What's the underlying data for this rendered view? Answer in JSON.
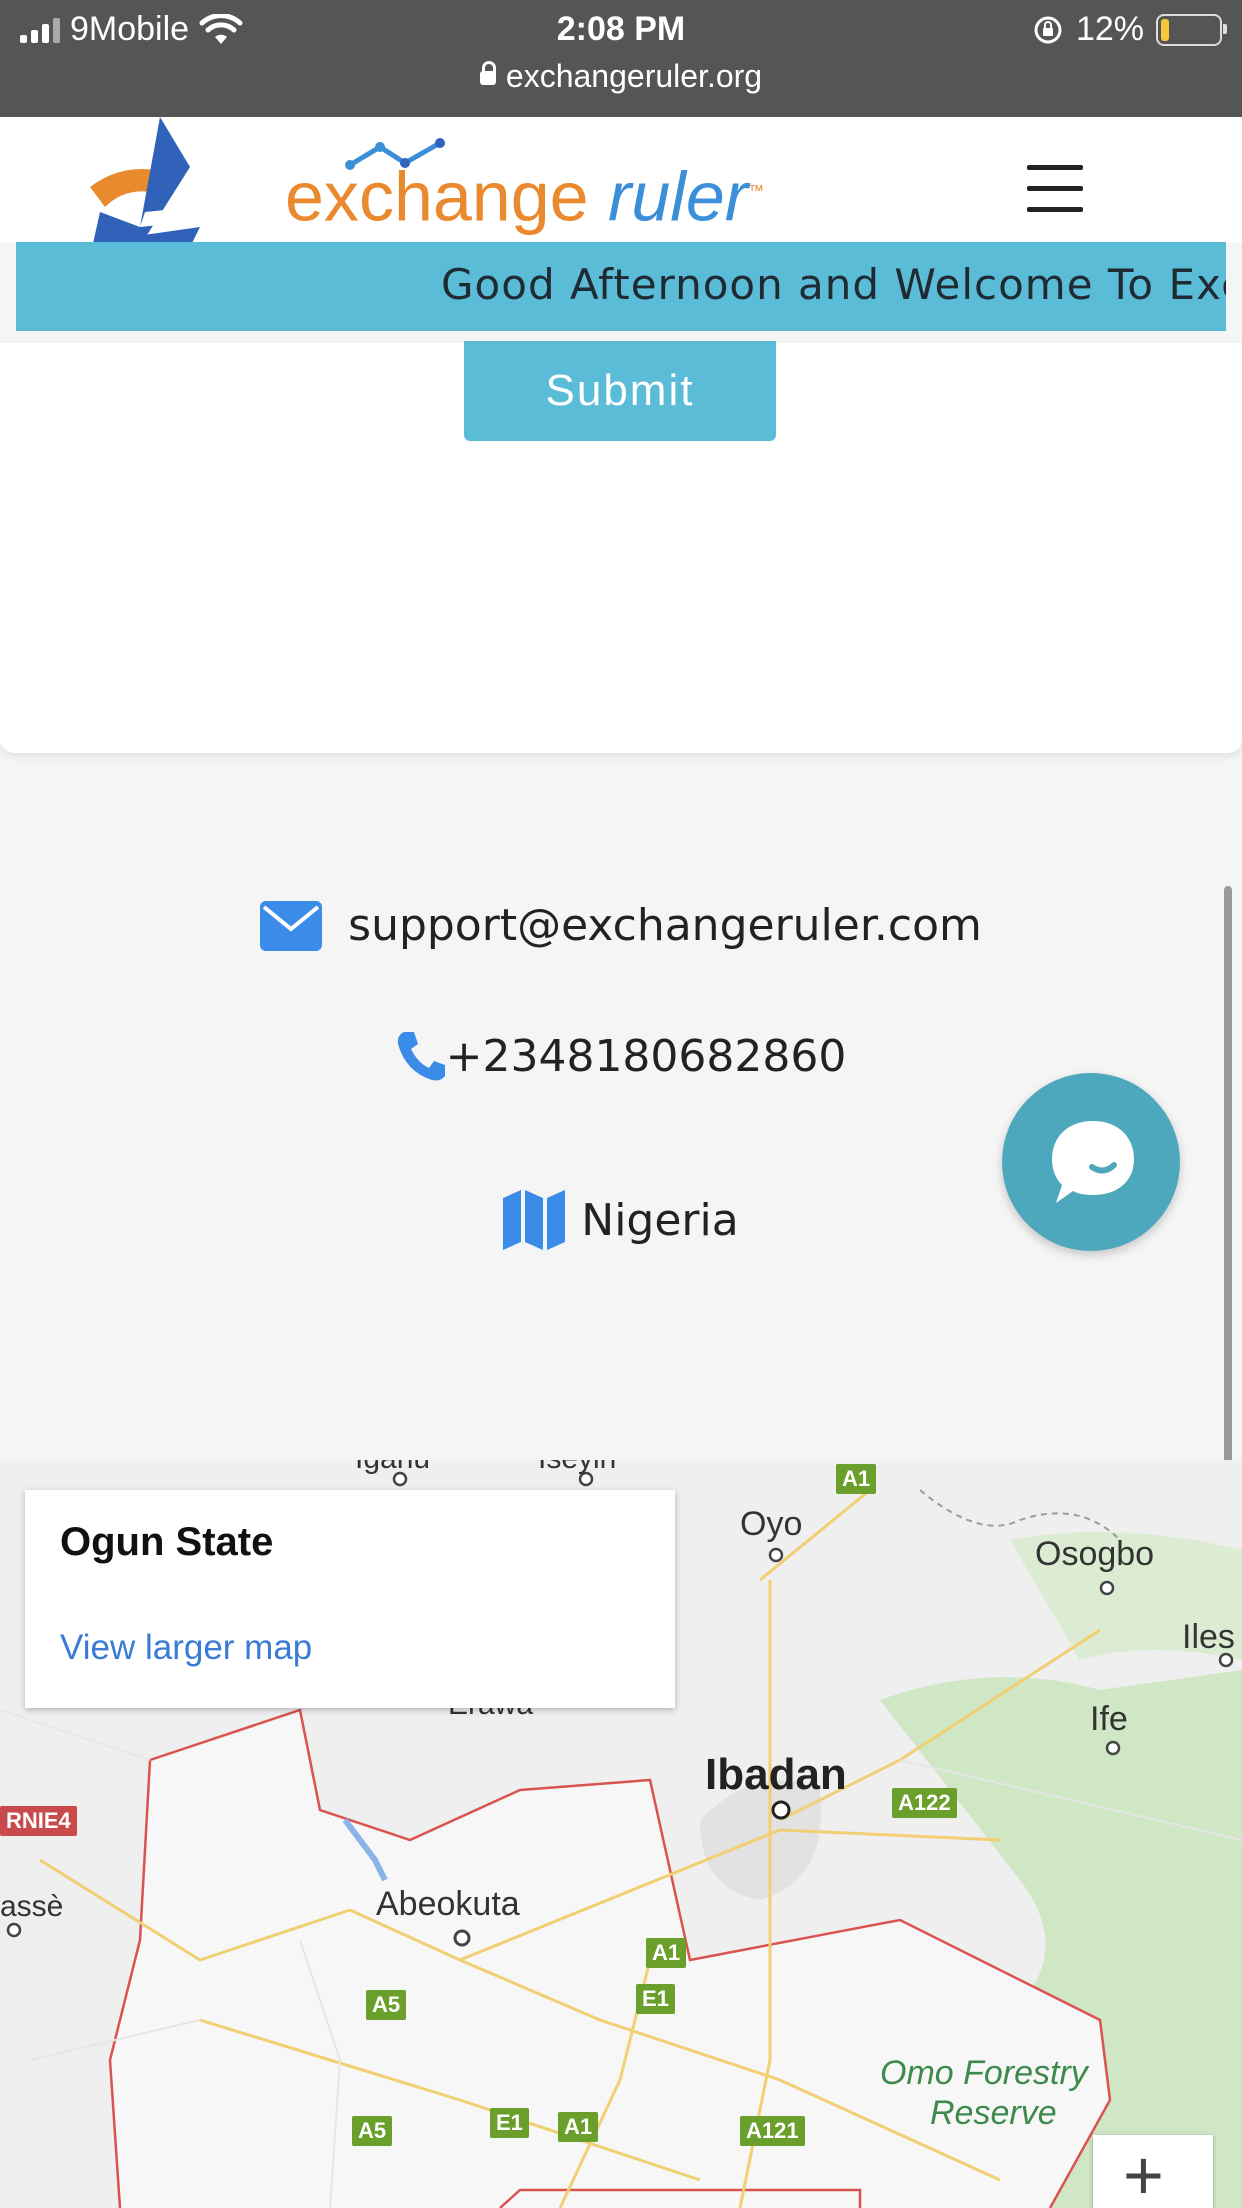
{
  "status_bar": {
    "carrier": "9Mobile",
    "time": "2:08 PM",
    "battery": "12%",
    "url": "exchangeruler.org"
  },
  "header": {
    "logo_ex": "ex",
    "logo_change": "change",
    "logo_ruler": "ruler",
    "logo_mark": "™"
  },
  "marquee": {
    "text": "Good Afternoon and Welcome To Exch"
  },
  "form": {
    "submit_label": "Submit"
  },
  "contact": {
    "email": "support@exchangeruler.com",
    "phone": "+2348180682860",
    "location": "Nigeria"
  },
  "map": {
    "info_title": "Ogun State",
    "info_link": "View larger map",
    "places": [
      "Oyo",
      "Osogbo",
      "Iles",
      "Erawa",
      "Ife",
      "Ibadan",
      "Abeokuta",
      "assè",
      "Omo Forestry",
      "Reserve",
      "Iganu",
      "Iseyin"
    ],
    "roads": [
      "A1",
      "A122",
      "RNIE4",
      "A5",
      "E1",
      "A1",
      "A5",
      "E1",
      "A1",
      "A121"
    ],
    "zoom_in_label": "+"
  },
  "colors": {
    "accent": "#5bbcd8",
    "logo_orange": "#ea8a2f",
    "logo_blue": "#3b8fd8",
    "icon_blue": "#3b8be8",
    "chat_button": "#4ea8bd"
  }
}
